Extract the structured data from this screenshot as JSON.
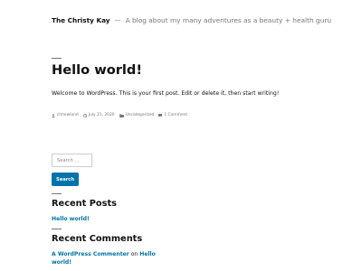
{
  "header": {
    "site_title": "The Christy Kay",
    "separator": "—",
    "tagline": "A blog about my many adventures as a beauty + health guru"
  },
  "post": {
    "title": "Hello world!",
    "body": "Welcome to WordPress. This is your first post. Edit or delete it, then start writing!",
    "meta": {
      "author": "clmewland",
      "date": "July 21, 2020",
      "category": "Uncategorized",
      "comments": "1 Comment"
    }
  },
  "search": {
    "placeholder": "Search …",
    "button_label": "Search"
  },
  "recent_posts": {
    "title": "Recent Posts",
    "items": [
      {
        "label": "Hello world!"
      }
    ]
  },
  "recent_comments": {
    "title": "Recent Comments",
    "items": [
      {
        "author": "A WordPress Commenter",
        "on": "on",
        "post": "Hello world!"
      }
    ]
  },
  "colors": {
    "link": "#0073aa",
    "muted": "#767676",
    "text": "#111111"
  }
}
